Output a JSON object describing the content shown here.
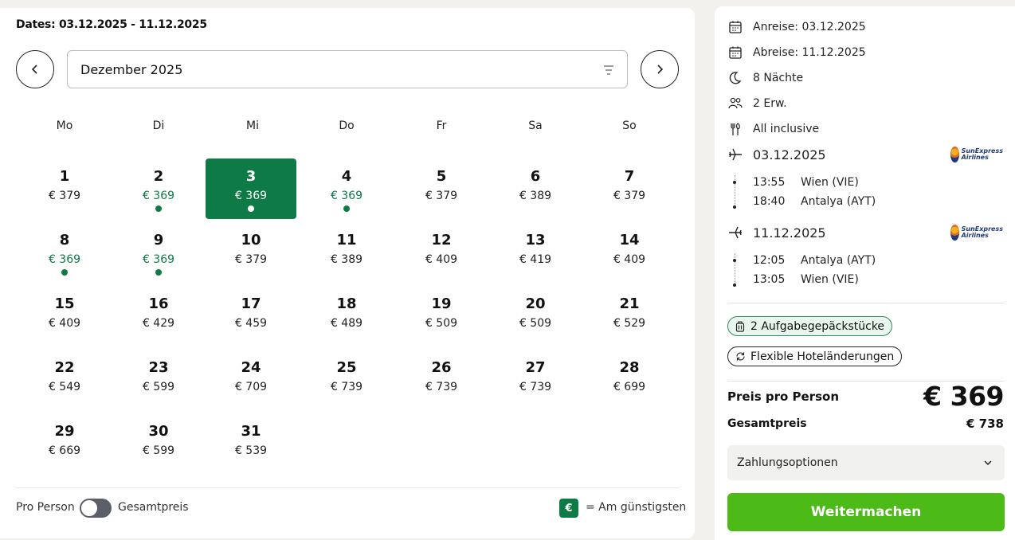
{
  "calendar": {
    "dates_label": "Dates:",
    "dates_range": "03.12.2025 - 11.12.2025",
    "month": "Dezember 2025",
    "weekdays": [
      "Mo",
      "Di",
      "Mi",
      "Do",
      "Fr",
      "Sa",
      "So"
    ],
    "days": [
      {
        "day": "1",
        "price": "€ 379",
        "cheap": false,
        "selected": false
      },
      {
        "day": "2",
        "price": "€ 369",
        "cheap": true,
        "selected": false
      },
      {
        "day": "3",
        "price": "€ 369",
        "cheap": true,
        "selected": true
      },
      {
        "day": "4",
        "price": "€ 369",
        "cheap": true,
        "selected": false
      },
      {
        "day": "5",
        "price": "€ 379",
        "cheap": false,
        "selected": false
      },
      {
        "day": "6",
        "price": "€ 389",
        "cheap": false,
        "selected": false
      },
      {
        "day": "7",
        "price": "€ 379",
        "cheap": false,
        "selected": false
      },
      {
        "day": "8",
        "price": "€ 369",
        "cheap": true,
        "selected": false
      },
      {
        "day": "9",
        "price": "€ 369",
        "cheap": true,
        "selected": false
      },
      {
        "day": "10",
        "price": "€ 379",
        "cheap": false,
        "selected": false
      },
      {
        "day": "11",
        "price": "€ 389",
        "cheap": false,
        "selected": false
      },
      {
        "day": "12",
        "price": "€ 409",
        "cheap": false,
        "selected": false
      },
      {
        "day": "13",
        "price": "€ 419",
        "cheap": false,
        "selected": false
      },
      {
        "day": "14",
        "price": "€ 409",
        "cheap": false,
        "selected": false
      },
      {
        "day": "15",
        "price": "€ 409",
        "cheap": false,
        "selected": false
      },
      {
        "day": "16",
        "price": "€ 429",
        "cheap": false,
        "selected": false
      },
      {
        "day": "17",
        "price": "€ 459",
        "cheap": false,
        "selected": false
      },
      {
        "day": "18",
        "price": "€ 489",
        "cheap": false,
        "selected": false
      },
      {
        "day": "19",
        "price": "€ 509",
        "cheap": false,
        "selected": false
      },
      {
        "day": "20",
        "price": "€ 509",
        "cheap": false,
        "selected": false
      },
      {
        "day": "21",
        "price": "€ 529",
        "cheap": false,
        "selected": false
      },
      {
        "day": "22",
        "price": "€ 549",
        "cheap": false,
        "selected": false
      },
      {
        "day": "23",
        "price": "€ 599",
        "cheap": false,
        "selected": false
      },
      {
        "day": "24",
        "price": "€ 709",
        "cheap": false,
        "selected": false
      },
      {
        "day": "25",
        "price": "€ 739",
        "cheap": false,
        "selected": false
      },
      {
        "day": "26",
        "price": "€ 739",
        "cheap": false,
        "selected": false
      },
      {
        "day": "27",
        "price": "€ 739",
        "cheap": false,
        "selected": false
      },
      {
        "day": "28",
        "price": "€ 699",
        "cheap": false,
        "selected": false
      },
      {
        "day": "29",
        "price": "€ 669",
        "cheap": false,
        "selected": false
      },
      {
        "day": "30",
        "price": "€ 599",
        "cheap": false,
        "selected": false
      },
      {
        "day": "31",
        "price": "€ 539",
        "cheap": false,
        "selected": false
      }
    ],
    "toggle_left_label": "Pro Person",
    "toggle_right_label": "Gesamtpreis",
    "toggle_on": false,
    "legend_symbol": "€",
    "legend_text": "= Am günstigsten",
    "colors": {
      "cheap": "#0e7a45",
      "selected_bg": "#0e7a45"
    }
  },
  "summary": {
    "arrival": "Anreise: 03.12.2025",
    "departure": "Abreise: 11.12.2025",
    "nights": "8 Nächte",
    "travellers": "2 Erw.",
    "board": "All inclusive",
    "outbound": {
      "date": "03.12.2025",
      "airline_logo_text": [
        "SunExpress",
        "Airlines"
      ],
      "segments": [
        {
          "time": "13:55",
          "airport": "Wien (VIE)"
        },
        {
          "time": "18:40",
          "airport": "Antalya (AYT)"
        }
      ]
    },
    "inbound": {
      "date": "11.12.2025",
      "airline_logo_text": [
        "SunExpress",
        "Airlines"
      ],
      "segments": [
        {
          "time": "12:05",
          "airport": "Antalya (AYT)"
        },
        {
          "time": "13:05",
          "airport": "Wien (VIE)"
        }
      ]
    },
    "chip_baggage": "2 Aufgabegepäckstücke",
    "chip_flexible": "Flexible Hoteländerungen",
    "price_label": "Preis pro Person",
    "price_value": "€ 369",
    "total_label": "Gesamtpreis",
    "total_value": "€ 738",
    "payment_options": "Zahlungsoptionen",
    "continue_button": "Weitermachen",
    "colors": {
      "continue": "#4cbb17"
    }
  },
  "icons": [
    "chevron-left-icon",
    "chevron-right-icon",
    "filter-icon",
    "calendar-icon",
    "moon-icon",
    "people-icon",
    "cutlery-icon",
    "plane-departure-icon",
    "plane-arrival-icon",
    "luggage-icon",
    "refresh-icon",
    "chevron-down-icon",
    "airline-logo"
  ]
}
